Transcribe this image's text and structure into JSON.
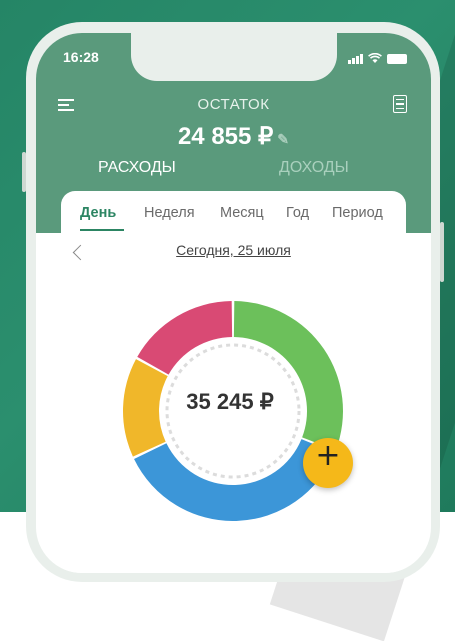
{
  "status_bar": {
    "time": "16:28"
  },
  "header": {
    "balance_label": "ОСТАТОК",
    "balance_value": "24 855 ₽",
    "tabs": [
      {
        "label": "РАСХОДЫ",
        "active": true
      },
      {
        "label": "ДОХОДЫ",
        "active": false
      }
    ]
  },
  "periods": [
    {
      "label": "День",
      "active": true
    },
    {
      "label": "Неделя",
      "active": false
    },
    {
      "label": "Месяц",
      "active": false
    },
    {
      "label": "Год",
      "active": false
    },
    {
      "label": "Период",
      "active": false
    }
  ],
  "date_label": "Сегодня, 25 июля",
  "total": "35 245 ₽",
  "chart_data": {
    "type": "pie",
    "segments": [
      {
        "color": "#6cc05b",
        "value": 0.31
      },
      {
        "color": "#3c96d8",
        "value": 0.37
      },
      {
        "color": "#f0b72a",
        "value": 0.15
      },
      {
        "color": "#d94a74",
        "value": 0.17
      }
    ]
  },
  "colors": {
    "accent": "#2c8563",
    "header": "#5a9a7c",
    "fab": "#f5b819"
  },
  "icons": {
    "menu": "menu-icon",
    "receipt": "receipt-icon",
    "edit": "pencil-icon",
    "back": "chevron-left-icon",
    "add": "plus-icon"
  }
}
